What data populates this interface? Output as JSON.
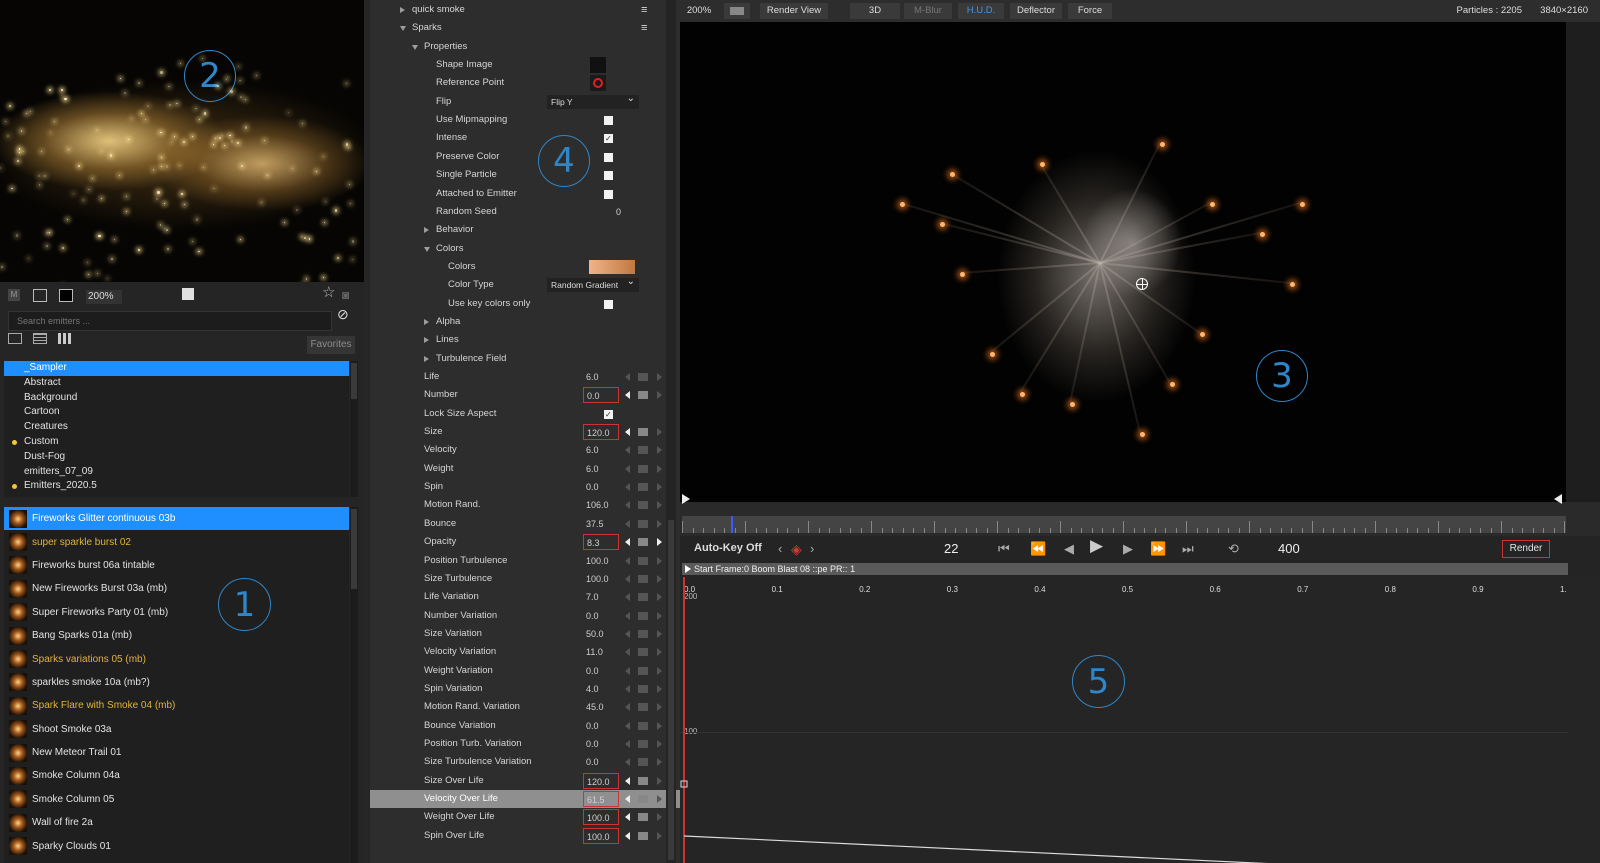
{
  "left": {
    "badge": "1",
    "preview_badge": "2",
    "zoom": "200%",
    "search_placeholder": "Search emitters ...",
    "favorites_label": "Favorites",
    "categories": [
      {
        "label": "_Sampler",
        "selected": true,
        "dot": false
      },
      {
        "label": "Abstract",
        "selected": false,
        "dot": false
      },
      {
        "label": "Background",
        "selected": false,
        "dot": false
      },
      {
        "label": "Cartoon",
        "selected": false,
        "dot": false
      },
      {
        "label": "Creatures",
        "selected": false,
        "dot": false
      },
      {
        "label": "Custom",
        "selected": false,
        "dot": true
      },
      {
        "label": "Dust-Fog",
        "selected": false,
        "dot": false
      },
      {
        "label": "emitters_07_09",
        "selected": false,
        "dot": false
      },
      {
        "label": "Emitters_2020.5",
        "selected": false,
        "dot": true
      }
    ],
    "presets": [
      {
        "label": "Fireworks Glitter continuous 03b",
        "selected": true,
        "gold": false
      },
      {
        "label": "super sparkle burst 02",
        "selected": false,
        "gold": true
      },
      {
        "label": "Fireworks burst 06a tintable",
        "selected": false,
        "gold": false
      },
      {
        "label": "New Fireworks Burst 03a (mb)",
        "selected": false,
        "gold": false
      },
      {
        "label": "Super Fireworks Party 01 (mb)",
        "selected": false,
        "gold": false
      },
      {
        "label": "Bang Sparks 01a (mb)",
        "selected": false,
        "gold": false
      },
      {
        "label": "Sparks variations 05 (mb)",
        "selected": false,
        "gold": true
      },
      {
        "label": "sparkles smoke 10a (mb?)",
        "selected": false,
        "gold": false
      },
      {
        "label": "Spark Flare with Smoke 04 (mb)",
        "selected": false,
        "gold": true
      },
      {
        "label": "Shoot Smoke 03a",
        "selected": false,
        "gold": false
      },
      {
        "label": "New Meteor Trail 01",
        "selected": false,
        "gold": false
      },
      {
        "label": "Smoke Column 04a",
        "selected": false,
        "gold": false
      },
      {
        "label": "Smoke Column 05",
        "selected": false,
        "gold": false
      },
      {
        "label": "Wall of fire 2a",
        "selected": false,
        "gold": false
      },
      {
        "label": "Sparky Clouds 01",
        "selected": false,
        "gold": false
      }
    ]
  },
  "props": {
    "badge": "4",
    "rows": [
      {
        "type": "group",
        "indent": 0,
        "open": false,
        "label": "quick smoke",
        "menu": true
      },
      {
        "type": "group",
        "indent": 0,
        "open": true,
        "label": "Sparks",
        "menu": true
      },
      {
        "type": "group",
        "indent": 1,
        "open": true,
        "label": "Properties"
      },
      {
        "type": "image",
        "indent": 2,
        "label": "Shape Image",
        "swatch": "shape"
      },
      {
        "type": "image",
        "indent": 2,
        "label": "Reference Point",
        "swatch": "refpoint"
      },
      {
        "type": "dropdown",
        "indent": 2,
        "label": "Flip",
        "value": "Flip Y"
      },
      {
        "type": "check",
        "indent": 2,
        "label": "Use Mipmapping",
        "checked": false
      },
      {
        "type": "check",
        "indent": 2,
        "label": "Intense",
        "checked": true
      },
      {
        "type": "check",
        "indent": 2,
        "label": "Preserve Color",
        "checked": false
      },
      {
        "type": "check",
        "indent": 2,
        "label": "Single Particle",
        "checked": false
      },
      {
        "type": "check",
        "indent": 2,
        "label": "Attached to Emitter",
        "checked": false
      },
      {
        "type": "text",
        "indent": 2,
        "label": "Random Seed",
        "value": "0"
      },
      {
        "type": "group",
        "indent": 2,
        "open": false,
        "label": "Behavior"
      },
      {
        "type": "group",
        "indent": 2,
        "open": true,
        "label": "Colors"
      },
      {
        "type": "gradient",
        "indent": 3,
        "label": "Colors"
      },
      {
        "type": "dropdown",
        "indent": 3,
        "label": "Color Type",
        "value": "Random Gradient"
      },
      {
        "type": "check",
        "indent": 3,
        "label": "Use key colors only",
        "checked": false
      },
      {
        "type": "group",
        "indent": 2,
        "open": false,
        "label": "Alpha"
      },
      {
        "type": "group",
        "indent": 2,
        "open": false,
        "label": "Lines"
      },
      {
        "type": "group",
        "indent": 2,
        "open": false,
        "label": "Turbulence Field"
      },
      {
        "type": "value",
        "indent": 1,
        "label": "Life",
        "value": "6.0",
        "red": false,
        "keyed": false
      },
      {
        "type": "value",
        "indent": 1,
        "label": "Number",
        "value": "0.0",
        "red": true,
        "keyed": true
      },
      {
        "type": "check",
        "indent": 1,
        "label": "Lock Size Aspect",
        "checked": true
      },
      {
        "type": "value",
        "indent": 1,
        "label": "Size",
        "value": "120.0",
        "red": true,
        "keyed": true
      },
      {
        "type": "value",
        "indent": 1,
        "label": "Velocity",
        "value": "6.0",
        "red": false,
        "keyed": false
      },
      {
        "type": "value",
        "indent": 1,
        "label": "Weight",
        "value": "6.0",
        "red": false,
        "keyed": false
      },
      {
        "type": "value",
        "indent": 1,
        "label": "Spin",
        "value": "0.0",
        "red": false,
        "keyed": false
      },
      {
        "type": "value",
        "indent": 1,
        "label": "Motion Rand.",
        "value": "106.0",
        "red": false,
        "keyed": false
      },
      {
        "type": "value",
        "indent": 1,
        "label": "Bounce",
        "value": "37.5",
        "red": false,
        "keyed": false
      },
      {
        "type": "value",
        "indent": 1,
        "label": "Opacity",
        "value": "8.3",
        "red": true,
        "keyed": true,
        "next": true
      },
      {
        "type": "value",
        "indent": 1,
        "label": "Position Turbulence",
        "value": "100.0",
        "red": false,
        "keyed": false
      },
      {
        "type": "value",
        "indent": 1,
        "label": "Size Turbulence",
        "value": "100.0",
        "red": false,
        "keyed": false
      },
      {
        "type": "value",
        "indent": 1,
        "label": "Life Variation",
        "value": "7.0",
        "red": false,
        "keyed": false
      },
      {
        "type": "value",
        "indent": 1,
        "label": "Number Variation",
        "value": "0.0",
        "red": false,
        "keyed": false
      },
      {
        "type": "value",
        "indent": 1,
        "label": "Size Variation",
        "value": "50.0",
        "red": false,
        "keyed": false
      },
      {
        "type": "value",
        "indent": 1,
        "label": "Velocity Variation",
        "value": "11.0",
        "red": false,
        "keyed": false
      },
      {
        "type": "value",
        "indent": 1,
        "label": "Weight Variation",
        "value": "0.0",
        "red": false,
        "keyed": false
      },
      {
        "type": "value",
        "indent": 1,
        "label": "Spin Variation",
        "value": "4.0",
        "red": false,
        "keyed": false
      },
      {
        "type": "value",
        "indent": 1,
        "label": "Motion Rand. Variation",
        "value": "45.0",
        "red": false,
        "keyed": false
      },
      {
        "type": "value",
        "indent": 1,
        "label": "Bounce Variation",
        "value": "0.0",
        "red": false,
        "keyed": false
      },
      {
        "type": "value",
        "indent": 1,
        "label": "Position Turb. Variation",
        "value": "0.0",
        "red": false,
        "keyed": false
      },
      {
        "type": "value",
        "indent": 1,
        "label": "Size Turbulence Variation",
        "value": "0.0",
        "red": false,
        "keyed": false
      },
      {
        "type": "value",
        "indent": 1,
        "label": "Size Over Life",
        "value": "120.0",
        "red": true,
        "keyed": true
      },
      {
        "type": "value",
        "indent": 1,
        "label": "Velocity Over Life",
        "value": "61.5",
        "red": true,
        "keyed": true,
        "highlight": true
      },
      {
        "type": "value",
        "indent": 1,
        "label": "Weight Over Life",
        "value": "100.0",
        "red": true,
        "keyed": true
      },
      {
        "type": "value",
        "indent": 1,
        "label": "Spin Over Life",
        "value": "100.0",
        "red": true,
        "keyed": true
      }
    ]
  },
  "viewer": {
    "badge": "3",
    "zoom": "200%",
    "render_view": "Render View",
    "btn_3d": "3D",
    "btn_mblur": "M-Blur",
    "btn_hud": "H.U.D.",
    "btn_deflector": "Deflector",
    "btn_force": "Force",
    "particles": "Particles : 2205",
    "resolution": "3840×2160"
  },
  "transport": {
    "autokey": "Auto-Key Off",
    "current_frame": "22",
    "end_frame": "400",
    "render_label": "Render",
    "playhead_fraction": 0.055
  },
  "graph": {
    "badge": "5",
    "clip_label": "Start Frame:0 Boom Blast 08 ::pe PR:: 1",
    "x_ticks": [
      "0.0",
      "0.1",
      "0.2",
      "0.3",
      "0.4",
      "0.5",
      "0.6",
      "0.7",
      "0.8",
      "0.9",
      "1."
    ],
    "y_ticks": [
      "200",
      "100"
    ],
    "curve": {
      "start_value": 61.5,
      "end_value": 0
    }
  },
  "colors": {
    "accent": "#1f8fff",
    "badge": "#2f86c8",
    "gold": "#e0b437",
    "key_red": "#cc3333",
    "gradient_start": "#f0b48a",
    "gradient_end": "#c07840"
  }
}
